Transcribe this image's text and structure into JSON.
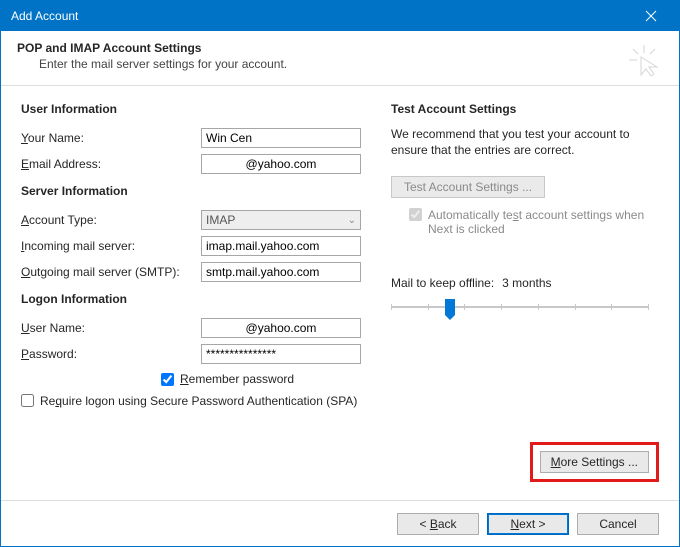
{
  "window": {
    "title": "Add Account"
  },
  "header": {
    "heading": "POP and IMAP Account Settings",
    "subheading": "Enter the mail server settings for your account."
  },
  "left": {
    "user_info_title": "User Information",
    "your_name_label": "Your Name:",
    "your_name_value": "Win Cen",
    "email_label": "Email Address:",
    "email_value": "@yahoo.com",
    "server_info_title": "Server Information",
    "account_type_label": "Account Type:",
    "account_type_value": "IMAP",
    "incoming_label": "Incoming mail server:",
    "incoming_value": "imap.mail.yahoo.com",
    "outgoing_label": "Outgoing mail server (SMTP):",
    "outgoing_value": "smtp.mail.yahoo.com",
    "logon_info_title": "Logon Information",
    "username_label": "User Name:",
    "username_value": "@yahoo.com",
    "password_label": "Password:",
    "password_value": "***************",
    "remember_pw_label": "Remember password",
    "spa_label": "Require logon using Secure Password Authentication (SPA)"
  },
  "right": {
    "test_title": "Test Account Settings",
    "test_note": "We recommend that you test your account to ensure that the entries are correct.",
    "test_btn": "Test Account Settings ...",
    "auto_test_label": "Automatically test account settings when Next is clicked",
    "mail_offline_label": "Mail to keep offline:",
    "mail_offline_value": "3 months",
    "more_settings_btn": "More Settings ..."
  },
  "footer": {
    "back": "< Back",
    "next": "Next >",
    "cancel": "Cancel"
  }
}
